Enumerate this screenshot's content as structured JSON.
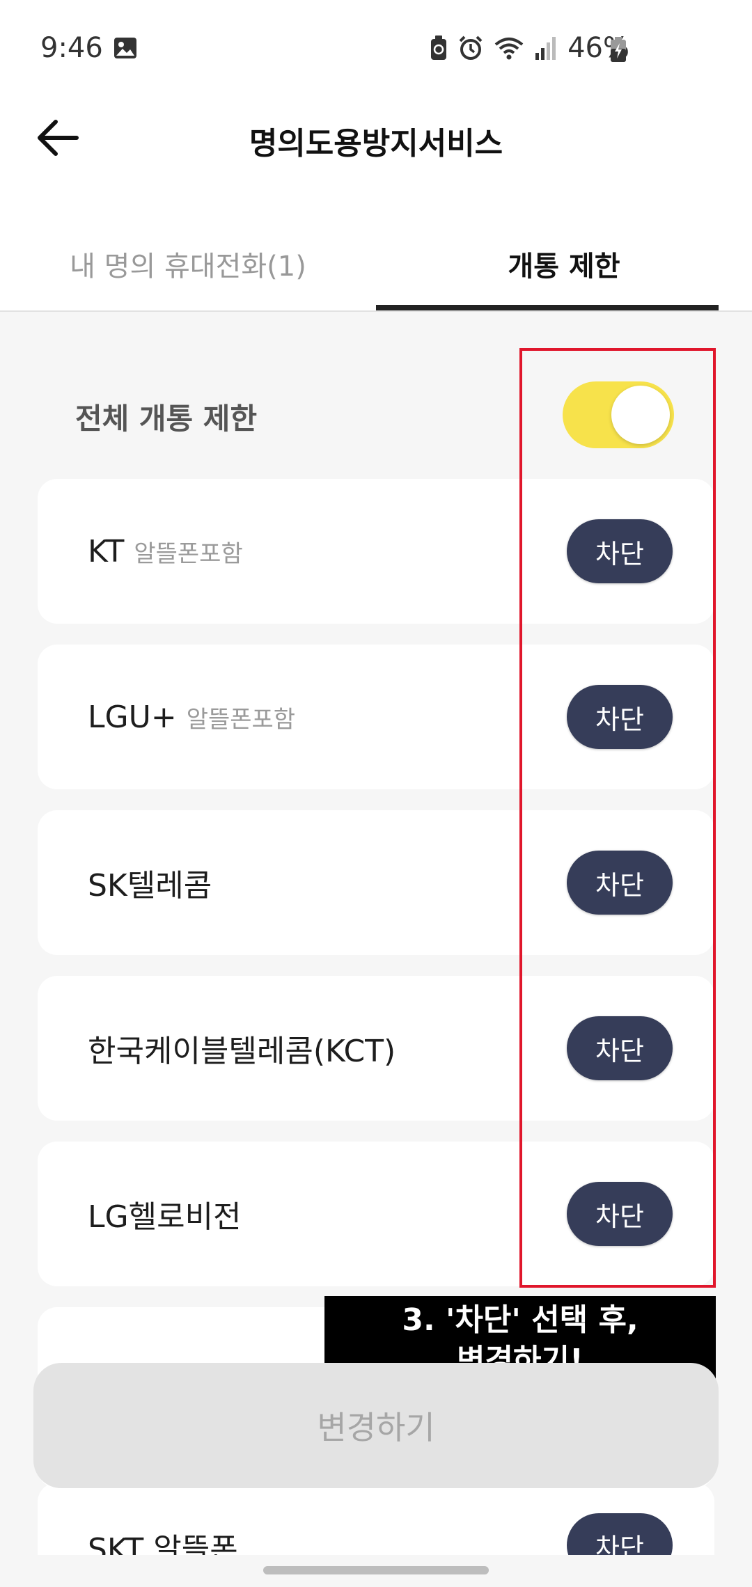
{
  "status_bar": {
    "time": "9:46",
    "battery_percent": "46%",
    "icons": [
      "image-icon",
      "battery-saver-icon",
      "alarm-icon",
      "wifi-icon",
      "signal-icon",
      "battery-charging-icon"
    ]
  },
  "header": {
    "title": "명의도용방지서비스",
    "back_icon": "arrow-left-icon"
  },
  "tabs": [
    {
      "label": "내 명의 휴대전화(1)",
      "active": false
    },
    {
      "label": "개통 제한",
      "active": true
    }
  ],
  "master": {
    "label": "전체 개통 제한",
    "toggle_on": true,
    "toggle_color": "#f7e24b"
  },
  "carriers": [
    {
      "name": "KT",
      "sub": "알뜰폰포함",
      "action": "차단"
    },
    {
      "name": "LGU+",
      "sub": "알뜰폰포함",
      "action": "차단"
    },
    {
      "name": "SK텔레콤",
      "sub": "",
      "action": "차단"
    },
    {
      "name": "한국케이블텔레콤(KCT)",
      "sub": "",
      "action": "차단"
    },
    {
      "name": "LG헬로비전",
      "sub": "",
      "action": "차단"
    },
    {
      "name": "SKT 알뜰폰",
      "sub": "",
      "action": "차단"
    }
  ],
  "overlay_caption": {
    "line1": "3. '차단' 선택 후,",
    "line2": "변경하기!"
  },
  "footer": {
    "change_label": "변경하기"
  },
  "colors": {
    "accent_yellow": "#f7e24b",
    "button_navy": "#363d59",
    "highlight_red": "#e0162b"
  }
}
